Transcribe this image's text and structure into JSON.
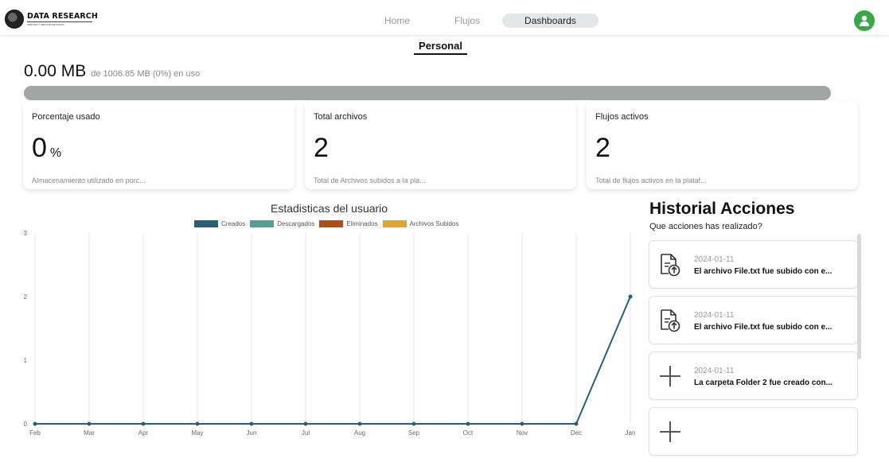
{
  "header": {
    "logo_text": "DATA RESEARCH",
    "logo_subtext": "ANÁLISIS Y GESTIÓN DE DATOS",
    "nav": [
      {
        "label": "Home",
        "active": false
      },
      {
        "label": "Flujos",
        "active": false
      },
      {
        "label": "Dashboards",
        "active": true
      }
    ]
  },
  "page": {
    "section_title": "Personal",
    "usage_value": "0.00 MB",
    "usage_detail": "de 1006.85 MB (0%) en uso",
    "usage_fraction": 0
  },
  "cards": [
    {
      "title": "Porcentaje usado",
      "value": "0",
      "unit": "%",
      "desc": "Almacenamiento utilizado en porc..."
    },
    {
      "title": "Total archivos",
      "value": "2",
      "unit": "",
      "desc": "Total de Archivos subidos a la pla..."
    },
    {
      "title": "Flujos activos",
      "value": "2",
      "unit": "",
      "desc": "Total de flujos activos en la plataf..."
    }
  ],
  "chart_data": {
    "type": "line",
    "title": "Estadisticas del usuario",
    "categories": [
      "Feb",
      "Mar",
      "Apr",
      "May",
      "Jun",
      "Jul",
      "Aug",
      "Sep",
      "Oct",
      "Nov",
      "Dec",
      "Jan"
    ],
    "ylim": [
      0,
      3
    ],
    "yticks": [
      0,
      1,
      2,
      3
    ],
    "grid": "vertical",
    "legend_position": "top",
    "series": [
      {
        "name": "Creados",
        "color": "#2d5f73",
        "values": [
          0,
          0,
          0,
          0,
          0,
          0,
          0,
          0,
          0,
          0,
          0,
          2
        ]
      },
      {
        "name": "Descargados",
        "color": "#5a9e91",
        "values": []
      },
      {
        "name": "Eliminados",
        "color": "#b34d12",
        "values": []
      },
      {
        "name": "Archivos Subidos",
        "color": "#e0a630",
        "values": []
      }
    ]
  },
  "history": {
    "title": "Historial Acciones",
    "subtitle": "Que acciones has realizado?",
    "items": [
      {
        "icon": "file-upload-icon",
        "date": "2024-01-11",
        "text": "El archivo File.txt fue subido con e..."
      },
      {
        "icon": "file-upload-icon",
        "date": "2024-01-11",
        "text": "El archivo File.txt fue subido con e..."
      },
      {
        "icon": "plus-icon",
        "date": "2024-01-11",
        "text": "La carpeta Folder 2 fue creado con..."
      },
      {
        "icon": "plus-icon",
        "date": "",
        "text": ""
      }
    ]
  },
  "colors": {
    "accent_avatar": "#3aa64a",
    "progress_track": "#a3a5a4"
  }
}
